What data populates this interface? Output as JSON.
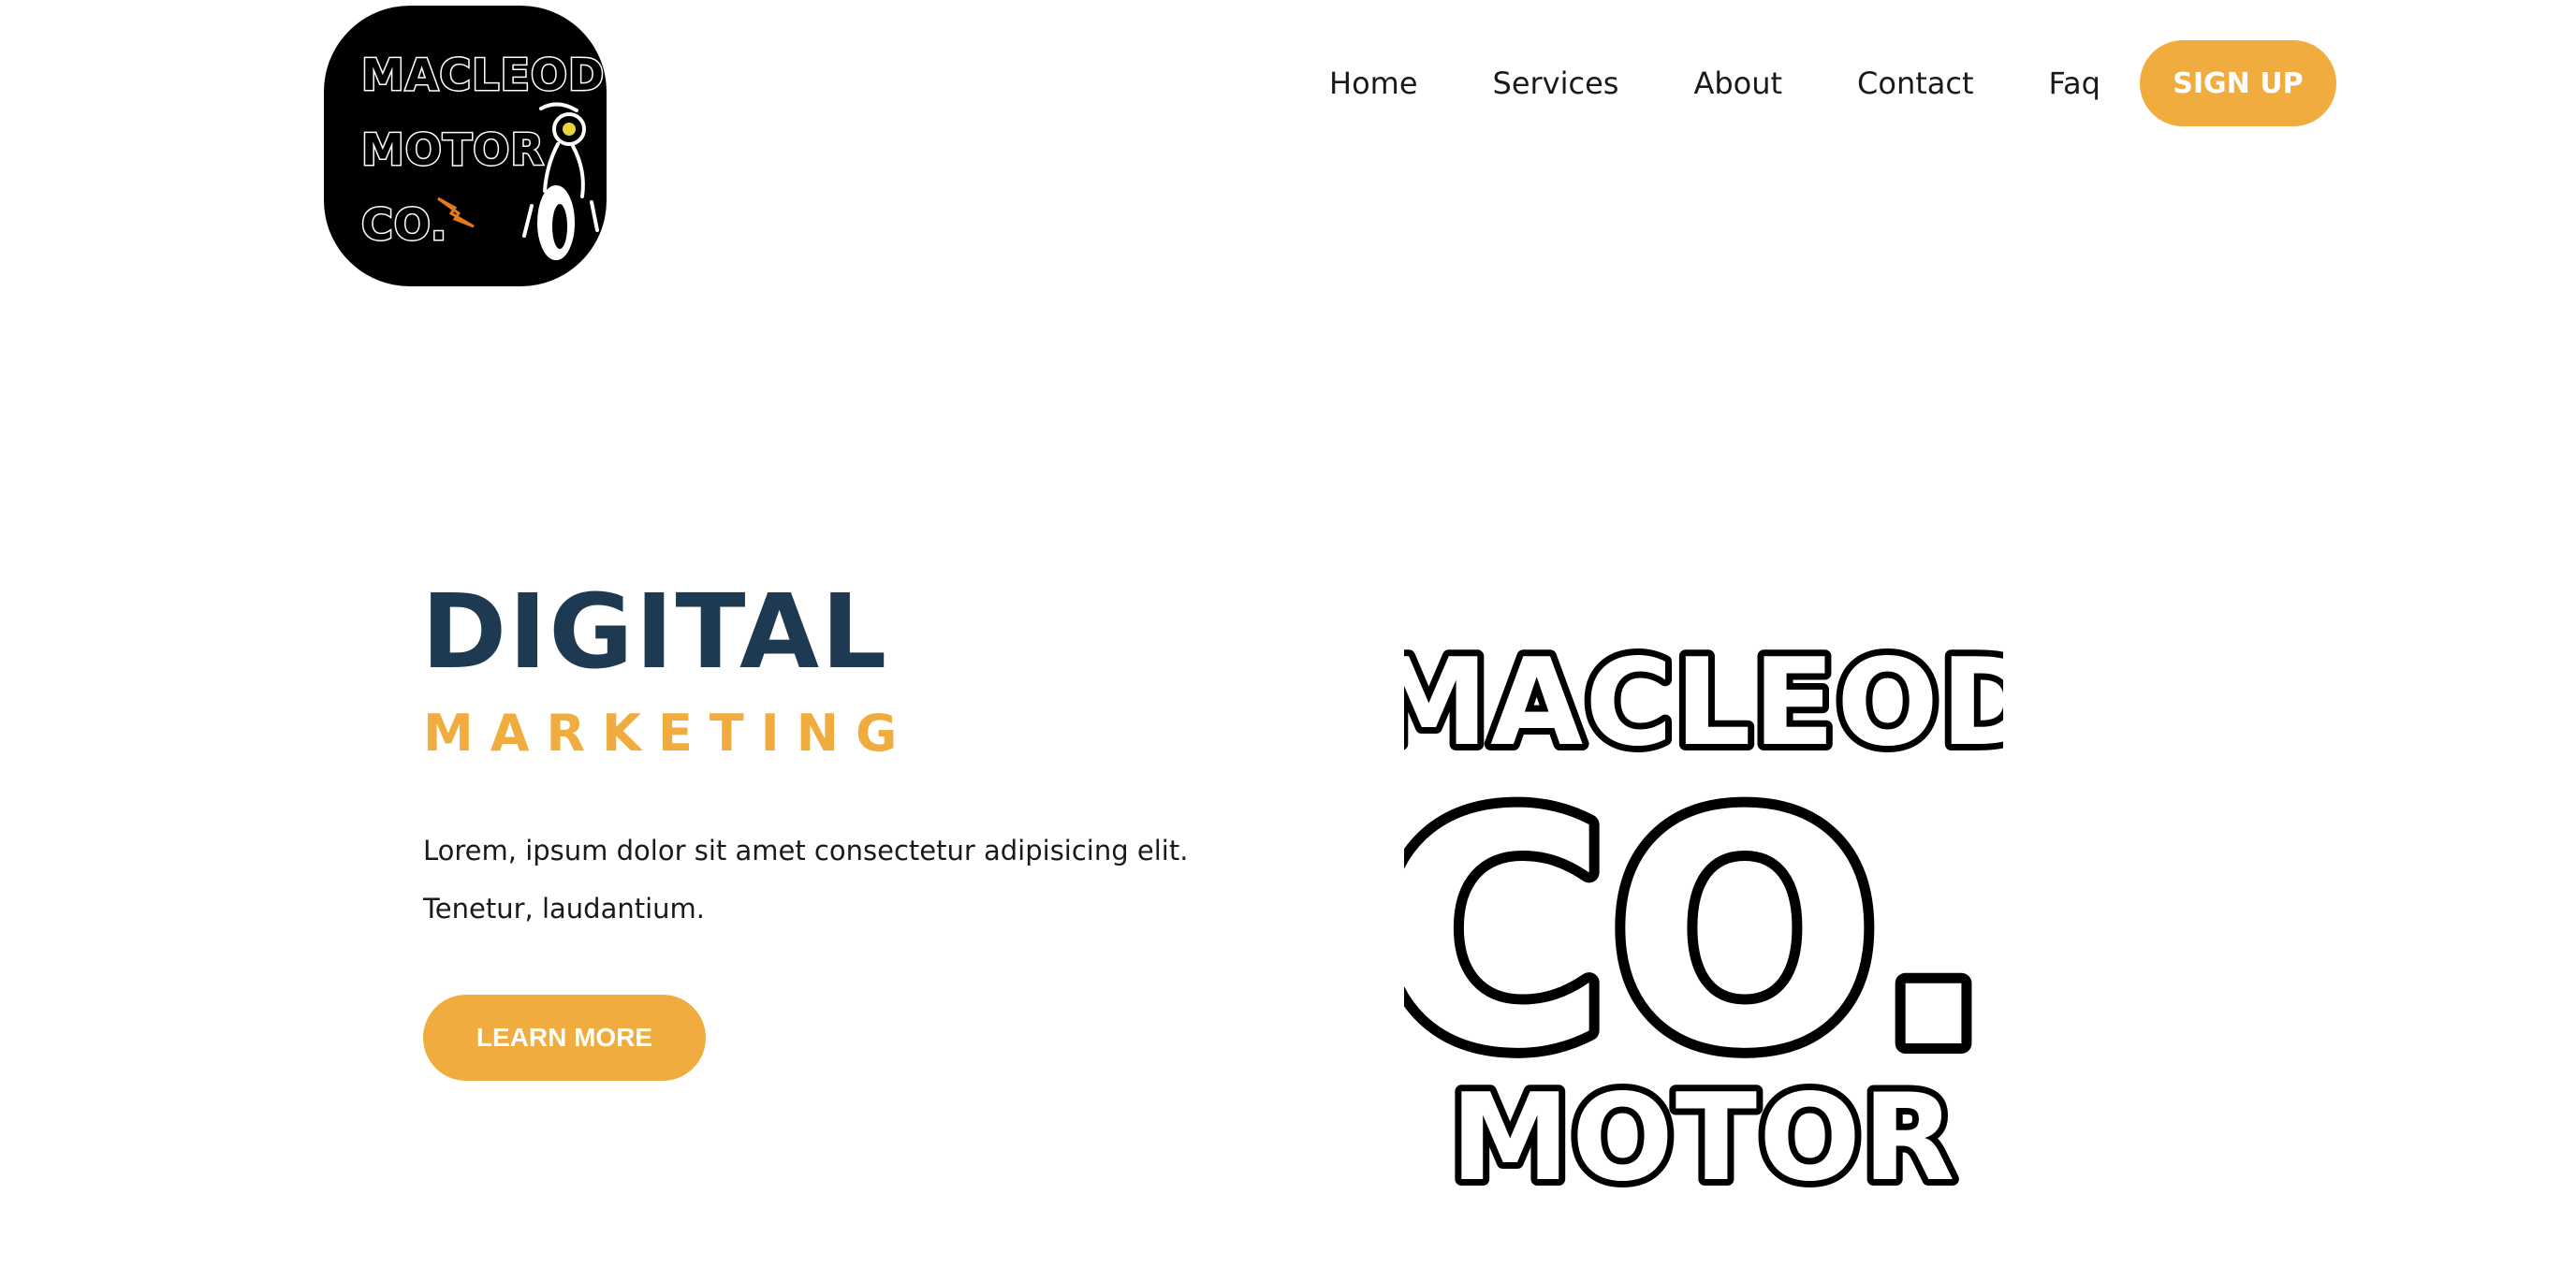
{
  "brand": {
    "logo_lines": [
      "MACLEOD",
      "MOTOR",
      "CO."
    ],
    "accent_color": "#f0ac3e",
    "heading_color": "#1e3a52"
  },
  "nav": {
    "items": [
      {
        "label": "Home"
      },
      {
        "label": "Services"
      },
      {
        "label": "About"
      },
      {
        "label": "Contact"
      },
      {
        "label": "Faq"
      }
    ],
    "signup_label": "SIGN UP"
  },
  "hero": {
    "title": "DIGITAL",
    "subtitle": "MARKETING",
    "body": "Lorem, ipsum dolor sit amet consectetur adipisicing elit. Tenetur, laudantium.",
    "cta_label": "LEARN MORE"
  },
  "hero_logo": {
    "line_top": "MACLEOD",
    "line_mid": "CO.",
    "line_bottom": "MOTOR"
  }
}
